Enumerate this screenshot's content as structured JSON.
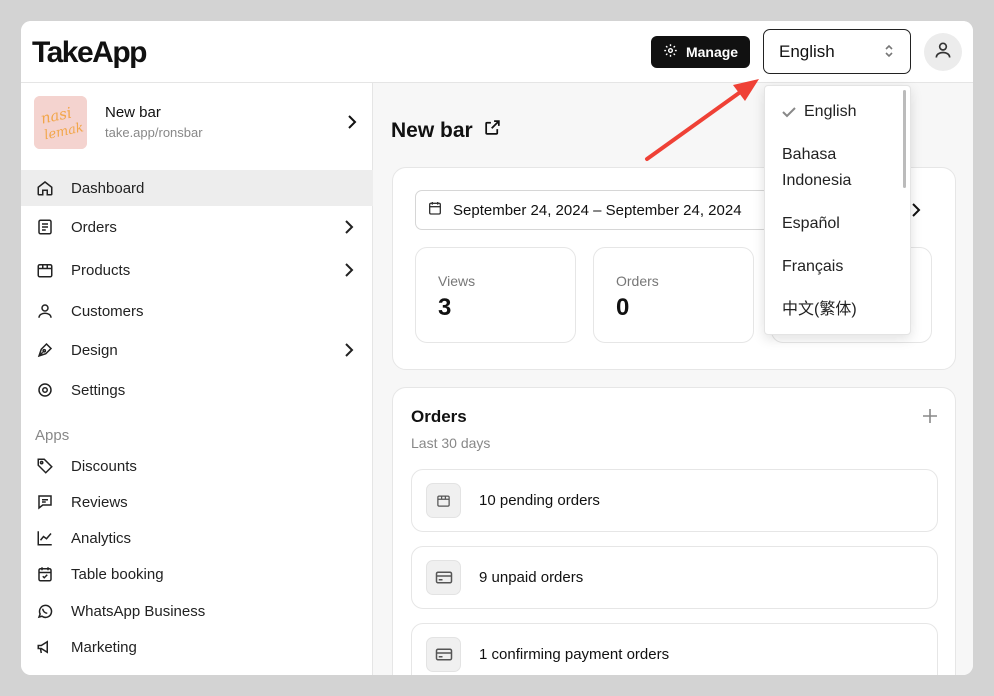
{
  "header": {
    "logo": "TakeApp",
    "manage_label": "Manage",
    "language_selected": "English"
  },
  "store": {
    "name": "New bar",
    "url": "take.app/ronsbar",
    "thumb_text": "nasi lemak"
  },
  "sidebar": {
    "items": [
      {
        "label": "Dashboard",
        "icon": "home-icon",
        "active": true
      },
      {
        "label": "Orders",
        "icon": "orders-list-icon"
      },
      {
        "label": "Products",
        "icon": "box-icon"
      },
      {
        "label": "Customers",
        "icon": "user-icon"
      },
      {
        "label": "Design",
        "icon": "pen-icon"
      },
      {
        "label": "Settings",
        "icon": "gear-icon"
      }
    ],
    "apps_label": "Apps",
    "apps": [
      {
        "label": "Discounts",
        "icon": "tag-icon"
      },
      {
        "label": "Reviews",
        "icon": "chat-icon"
      },
      {
        "label": "Analytics",
        "icon": "chart-icon"
      },
      {
        "label": "Table booking",
        "icon": "calendar-check-icon"
      },
      {
        "label": "WhatsApp Business",
        "icon": "whatsapp-icon"
      },
      {
        "label": "Marketing",
        "icon": "megaphone-icon"
      }
    ]
  },
  "main": {
    "title": "New bar",
    "date_range": "September 24, 2024 – September 24, 2024",
    "stats": [
      {
        "label": "Views",
        "value": "3"
      },
      {
        "label": "Orders",
        "value": "0"
      }
    ],
    "orders": {
      "title": "Orders",
      "subtitle": "Last 30 days",
      "rows": [
        {
          "label": "10 pending orders",
          "icon": "box-icon"
        },
        {
          "label": "9 unpaid orders",
          "icon": "credit-card-icon"
        },
        {
          "label": "1 confirming payment orders",
          "icon": "credit-card-icon"
        }
      ]
    }
  },
  "language_dropdown": {
    "options": [
      "English",
      "Bahasa Indonesia",
      "Español",
      "Français",
      "中文(繁体)"
    ],
    "selected": "English"
  },
  "colors": {
    "accent": "#111111",
    "annotation_arrow": "#ef4136",
    "active_nav_bg": "#ededed"
  }
}
